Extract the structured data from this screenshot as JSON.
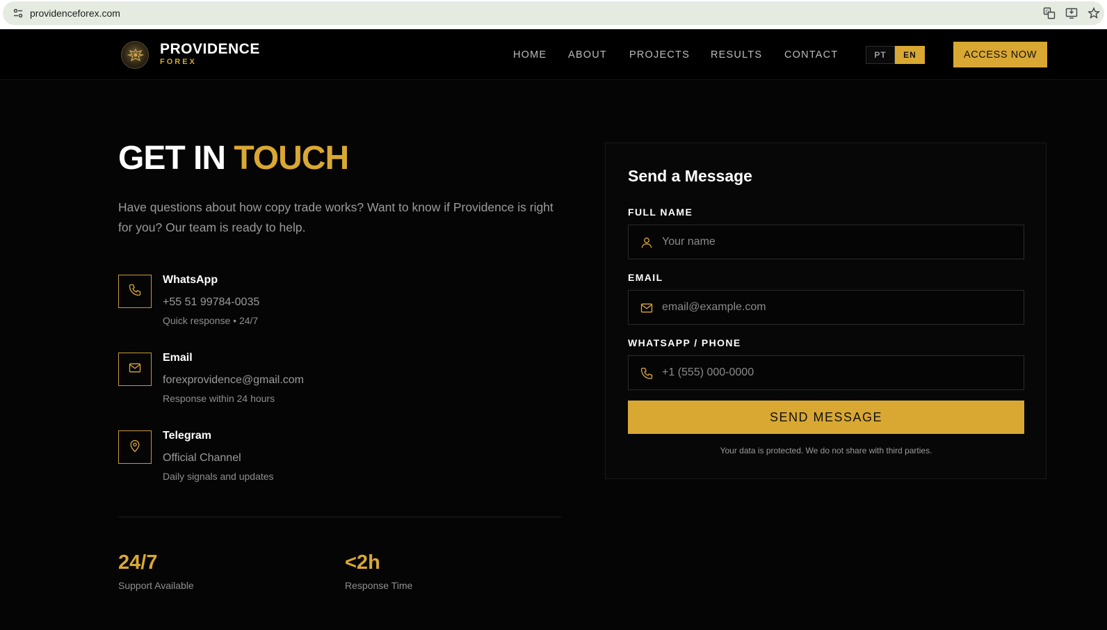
{
  "browser": {
    "url": "providenceforex.com",
    "icons": [
      "site-settings-icon",
      "translate-icon",
      "install-app-icon",
      "bookmark-star-icon"
    ]
  },
  "header": {
    "brand_name": "PROVIDENCE",
    "brand_sub": "FOREX",
    "logo_icon": "eagle-emblem-icon",
    "nav": [
      "HOME",
      "ABOUT",
      "PROJECTS",
      "RESULTS",
      "CONTACT"
    ],
    "languages": [
      {
        "label": "PT",
        "active": false
      },
      {
        "label": "EN",
        "active": true
      }
    ],
    "cta": "ACCESS NOW"
  },
  "hero": {
    "title_white": "GET IN ",
    "title_gold": "TOUCH",
    "intro": "Have questions about how copy trade works? Want to know if Providence is right for you? Our team is ready to help."
  },
  "contacts": [
    {
      "icon": "phone-icon",
      "title": "WhatsApp",
      "value": "+55 51 99784-0035",
      "note": "Quick response • 24/7"
    },
    {
      "icon": "mail-icon",
      "title": "Email",
      "value": "forexprovidence@gmail.com",
      "note": "Response within 24 hours"
    },
    {
      "icon": "map-pin-icon",
      "title": "Telegram",
      "value": "Official Channel",
      "note": "Daily signals and updates"
    }
  ],
  "stats": [
    {
      "value": "24/7",
      "label": "Support Available"
    },
    {
      "value": "<2h",
      "label": "Response Time"
    }
  ],
  "form": {
    "title": "Send a Message",
    "fields": [
      {
        "label": "FULL NAME",
        "placeholder": "Your name",
        "icon": "user-icon"
      },
      {
        "label": "EMAIL",
        "placeholder": "email@example.com",
        "icon": "mail-icon"
      },
      {
        "label": "WHATSAPP / PHONE",
        "placeholder": "+1 (555) 000-0000",
        "icon": "phone-icon"
      }
    ],
    "submit": "SEND MESSAGE",
    "privacy": "Your data is protected. We do not share with third parties."
  },
  "colors": {
    "accent_gold": "#d9a833",
    "background": "#060506",
    "muted_text": "#9b9b9b"
  }
}
